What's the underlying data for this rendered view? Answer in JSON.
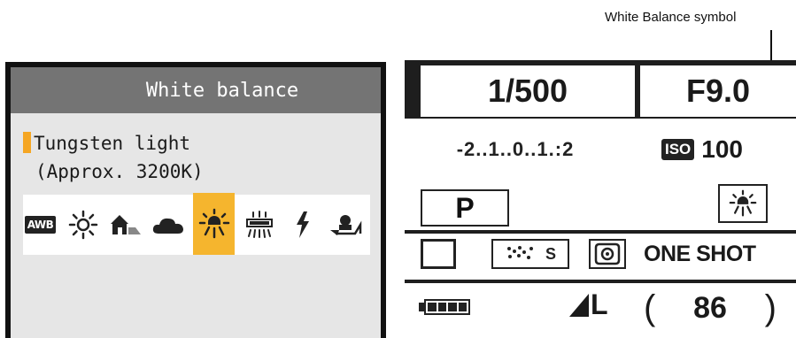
{
  "callout": {
    "label": "White Balance symbol"
  },
  "wb_menu": {
    "title": "White balance",
    "selected_name": "Tungsten light",
    "selected_kelvin": "(Approx. 3200K)",
    "options": [
      {
        "icon": "auto-white-balance-icon",
        "text": "AWB"
      },
      {
        "icon": "daylight-sun-icon"
      },
      {
        "icon": "shade-house-icon"
      },
      {
        "icon": "cloudy-icon"
      },
      {
        "icon": "tungsten-light-icon",
        "selected": true
      },
      {
        "icon": "fluorescent-light-icon"
      },
      {
        "icon": "flash-icon"
      },
      {
        "icon": "custom-white-balance-icon"
      }
    ],
    "accent": "#f5b52e"
  },
  "lcd": {
    "shutter": "1/500",
    "aperture": "F9.0",
    "exposure_scale": "-2..1..0..1.:2",
    "iso_label": "ISO",
    "iso_value": "100",
    "mode": "P",
    "picture_style": "S",
    "af_mode": "ONE SHOT",
    "quality": "L",
    "shots_open": "(",
    "shots_remaining": "86",
    "shots_close": ")"
  }
}
